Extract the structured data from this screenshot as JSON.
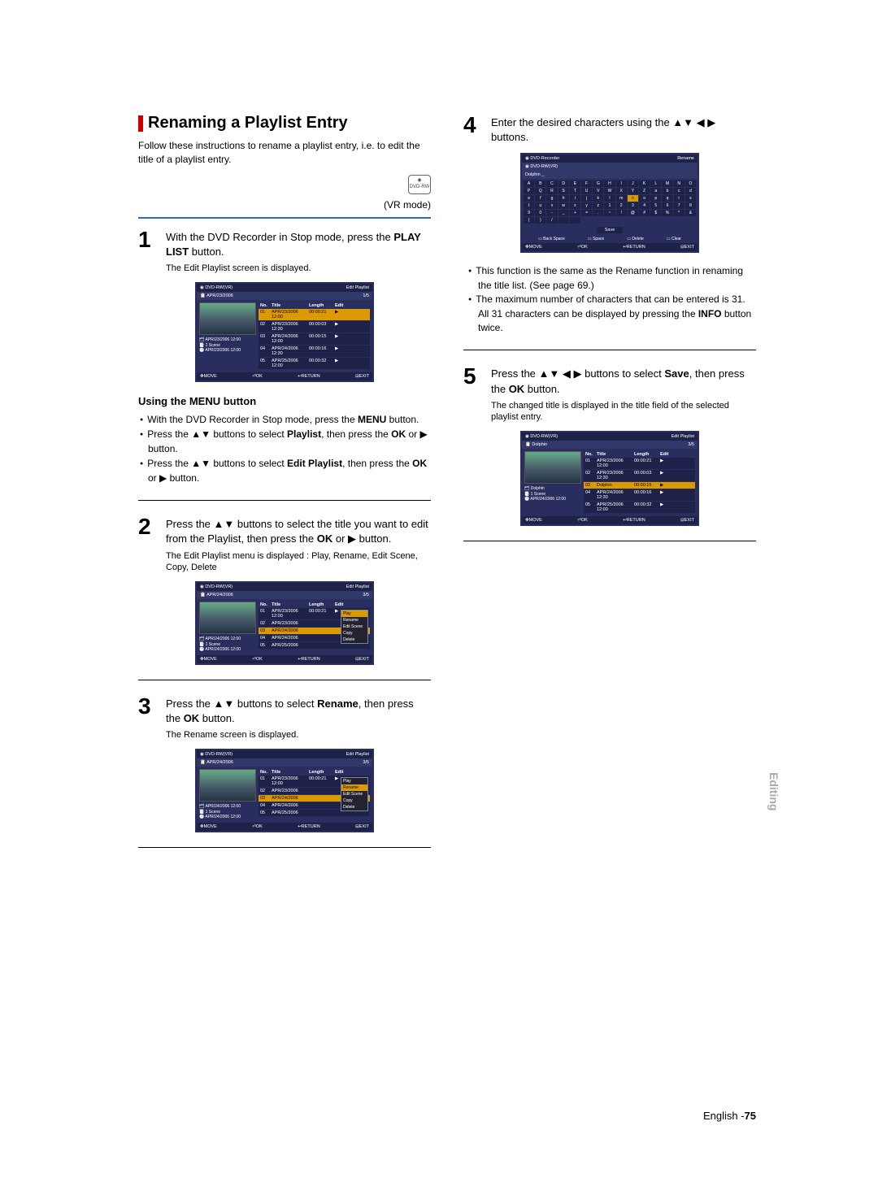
{
  "section": {
    "title": "Renaming a Playlist Entry"
  },
  "intro": "Follow these instructions to rename a playlist entry, i.e. to edit the title of a playlist entry.",
  "mode": {
    "icon_label": "DVD-RW",
    "label": "(VR mode)"
  },
  "steps": {
    "s1": {
      "num": "1",
      "text_a": "With the DVD Recorder in Stop mode, press the ",
      "bold_a": "PLAY LIST",
      "text_b": " button.",
      "sub": "The Edit Playlist screen is displayed."
    },
    "s2": {
      "num": "2",
      "text_a": "Press the ",
      "arrows_a": "▲▼",
      "text_b": " buttons to select the title you want to edit from the Playlist, then press the ",
      "bold_a": "OK",
      "text_c": " or ",
      "arrows_b": "▶",
      "text_d": " button.",
      "sub": "The Edit Playlist menu is displayed : Play, Rename, Edit Scene, Copy, Delete"
    },
    "s3": {
      "num": "3",
      "text_a": "Press the ",
      "arrows_a": "▲▼",
      "text_b": " buttons to select ",
      "bold_a": "Rename",
      "text_c": ", then press the ",
      "bold_b": "OK",
      "text_d": " button.",
      "sub": "The Rename screen is displayed."
    },
    "s4": {
      "num": "4",
      "text_a": "Enter the desired characters using the ",
      "arrows_a": "▲▼ ◀ ▶",
      "text_b": " buttons."
    },
    "s5": {
      "num": "5",
      "text_a": "Press the ",
      "arrows_a": "▲▼ ◀ ▶",
      "text_b": " buttons to select ",
      "bold_a": "Save",
      "text_c": ", then press the ",
      "bold_b": "OK",
      "text_d": " button.",
      "sub": "The changed title is displayed in the title field of the selected playlist entry."
    }
  },
  "menu_section": {
    "heading": "Using the MENU button",
    "b1_a": "With the DVD Recorder in Stop mode, press the ",
    "b1_bold": "MENU",
    "b1_b": " button.",
    "b2_a": "Press the ",
    "b2_arrows": "▲▼",
    "b2_b": " buttons to select ",
    "b2_bold": "Playlist",
    "b2_c": ", then press the ",
    "b2_bold2": "OK",
    "b2_d": " or ",
    "b2_arrows2": "▶",
    "b2_e": " button.",
    "b3_a": "Press the ",
    "b3_arrows": "▲▼",
    "b3_b": " buttons to select ",
    "b3_bold": "Edit Playlist",
    "b3_c": ", then press the ",
    "b3_bold2": "OK",
    "b3_d": " or ",
    "b3_arrows2": "▶",
    "b3_e": " button."
  },
  "notes": {
    "n1_a": "This function is the same as the Rename function in renaming the title list. (See page 69.)",
    "n2_a": "The maximum number of characters that can be entered is 31. All 31 characters can be displayed by pressing the ",
    "n2_bold": "INFO",
    "n2_b": " button twice."
  },
  "ss1": {
    "dvd": "DVD-RW(VR)",
    "title": "Edit Playlist",
    "date": "APR/23/2006",
    "page": "1/5",
    "th_no": "No.",
    "th_title": "Title",
    "th_len": "Length",
    "th_edit": "Edit",
    "r1": {
      "no": "01",
      "title": "APR/23/2006 12:00",
      "len": "00:00:21",
      "ed": "▶"
    },
    "r2": {
      "no": "02",
      "title": "APR/23/2006 12:30",
      "len": "00:00:03",
      "ed": "▶"
    },
    "r3": {
      "no": "03",
      "title": "APR/24/2006 12:00",
      "len": "00:00:15",
      "ed": "▶"
    },
    "r4": {
      "no": "04",
      "title": "APR/24/2006 12:30",
      "len": "00:00:16",
      "ed": "▶"
    },
    "r5": {
      "no": "05",
      "title": "APR/25/2006 12:00",
      "len": "00:00:32",
      "ed": "▶"
    },
    "meta1": "APR/23/2006 12:00",
    "meta2": "1 Scene",
    "meta3": "APR/23/2006 12:00",
    "f_move": "MOVE",
    "f_ok": "OK",
    "f_return": "RETURN",
    "f_exit": "EXIT"
  },
  "ss2": {
    "dvd": "DVD-RW(VR)",
    "title": "Edit Playlist",
    "date": "APR/24/2006",
    "page": "3/5",
    "r1": {
      "no": "01",
      "title": "APR/23/2006 12:00",
      "len": "00:00:21",
      "ed": "▶"
    },
    "r2": {
      "no": "02",
      "title": "APR/23/2006",
      "len": "",
      "ed": ""
    },
    "r3": {
      "no": "03",
      "title": "APR/24/2006",
      "len": "",
      "ed": ""
    },
    "r4": {
      "no": "04",
      "title": "APR/24/2006",
      "len": "",
      "ed": ""
    },
    "r5": {
      "no": "05",
      "title": "APR/25/2006",
      "len": "",
      "ed": ""
    },
    "meta1": "APR/24/2006 12:00",
    "meta2": "1 Scene",
    "meta3": "APR/24/2006 12:00",
    "menu": {
      "p1": "Play",
      "p2": "Rename",
      "p3": "Edit Scene",
      "p4": "Copy",
      "p5": "Delete"
    }
  },
  "ss3": {
    "dvd": "DVD-RW(VR)",
    "title": "Edit Playlist",
    "date": "APR/24/2006",
    "page": "3/5",
    "meta1": "APR/24/2006 12:00",
    "meta2": "1 Scene",
    "meta3": "APR/24/2006 12:00",
    "menu": {
      "p1": "Play",
      "p2": "Rename",
      "p3": "Edit Scene",
      "p4": "Copy",
      "p5": "Delete"
    }
  },
  "ss4": {
    "top": "DVD-Recorder",
    "title": "Rename",
    "dvd": "DVD-RW(VR)",
    "name_label": "Dolphin",
    "cursor": "_",
    "keys_r1": [
      "A",
      "B",
      "C",
      "D",
      "E",
      "F",
      "G",
      "H",
      "I",
      "J",
      "K",
      "L",
      "M",
      "N",
      "O",
      "P"
    ],
    "keys_r2": [
      "Q",
      "R",
      "S",
      "T",
      "U",
      "V",
      "W",
      "X",
      "Y",
      "Z",
      "a",
      "b",
      "c",
      "d",
      "e",
      "f"
    ],
    "keys_r3": [
      "g",
      "h",
      "i",
      "j",
      "k",
      "l",
      "m",
      "n",
      "o",
      "p",
      "q",
      "r",
      "s",
      "t",
      "u",
      "v"
    ],
    "keys_r4": [
      "w",
      "x",
      "y",
      "z",
      "1",
      "2",
      "3",
      "4",
      "5",
      "6",
      "7",
      "8",
      "9",
      "0",
      "-",
      "_"
    ],
    "keys_r5": [
      "+",
      "=",
      ".",
      "~",
      "!",
      "@",
      "#",
      "$",
      "%",
      "^",
      "&",
      "(",
      ")",
      "/",
      "",
      ""
    ],
    "save": "Save",
    "a1": "Back Space",
    "a2": "Space",
    "a3": "Delete",
    "a4": "Clear",
    "f_move": "MOVE",
    "f_ok": "OK",
    "f_return": "RETURN",
    "f_exit": "EXIT"
  },
  "ss5": {
    "dvd": "DVD-RW(VR)",
    "title": "Edit Playlist",
    "date": "Dolphin",
    "page": "3/5",
    "r1": {
      "no": "01",
      "title": "APR/23/2006 12:00",
      "len": "00:00:21",
      "ed": "▶"
    },
    "r2": {
      "no": "02",
      "title": "APR/23/2006 12:30",
      "len": "00:00:03",
      "ed": "▶"
    },
    "r3": {
      "no": "03",
      "title": "Dolphin",
      "len": "00:00:15",
      "ed": "▶"
    },
    "r4": {
      "no": "04",
      "title": "APR/24/2006 12:30",
      "len": "00:00:16",
      "ed": "▶"
    },
    "r5": {
      "no": "05",
      "title": "APR/25/2006 12:00",
      "len": "00:00:32",
      "ed": "▶"
    },
    "meta1": "Dolphin",
    "meta2": "1 Scene",
    "meta3": "APR/24/2006 12:00"
  },
  "footer": {
    "lang": "English -",
    "page": "75"
  },
  "sidetab": "Editing"
}
